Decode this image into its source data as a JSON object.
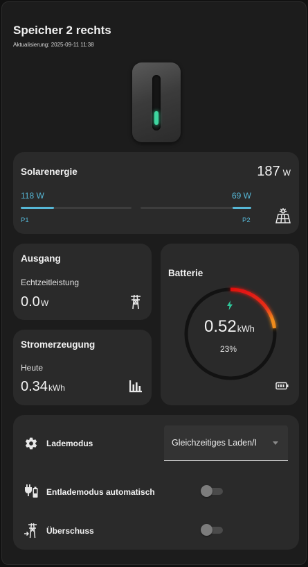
{
  "header": {
    "title": "Speicher 2 rechts",
    "updated": "Aktualisierung: 2025-09-11 11:38"
  },
  "solar": {
    "title": "Solarenergie",
    "total_value": "187",
    "total_unit": "W",
    "p1": {
      "value": "118 W",
      "label": "P1",
      "fraction": 0.3
    },
    "p2": {
      "value": "69 W",
      "label": "P2",
      "fraction": 0.17
    },
    "icon": "solar-panel-icon"
  },
  "ausgang": {
    "title": "Ausgang",
    "subtitle": "Echtzeitleistung",
    "value": "0.0",
    "unit": "W",
    "icon": "transmission-tower-icon"
  },
  "stromerzeugung": {
    "title": "Stromerzeugung",
    "subtitle": "Heute",
    "value": "0.34",
    "unit": "kWh",
    "icon": "bar-chart-icon"
  },
  "batterie": {
    "title": "Batterie",
    "value": "0.52",
    "unit": "kWh",
    "percent": "23%",
    "level": 0.23,
    "icons": [
      "lightning-bolt-icon",
      "battery-icon"
    ]
  },
  "controls": {
    "lademodus": {
      "label": "Lademodus",
      "selected": "Gleichzeitiges Laden/I",
      "icon": "gear-icon"
    },
    "entlademodus": {
      "label": "Entlademodus automatisch",
      "on": false,
      "icon": "plug-battery-icon"
    },
    "ueberschuss": {
      "label": "Überschuss",
      "on": false,
      "icon": "tower-export-icon"
    }
  },
  "colors": {
    "accent_blue": "#56b7d6",
    "led_green": "#3ed6a0",
    "arc_red": "#e01010",
    "arc_orange": "#f08c1a",
    "bolt_teal": "#2fc79a"
  }
}
